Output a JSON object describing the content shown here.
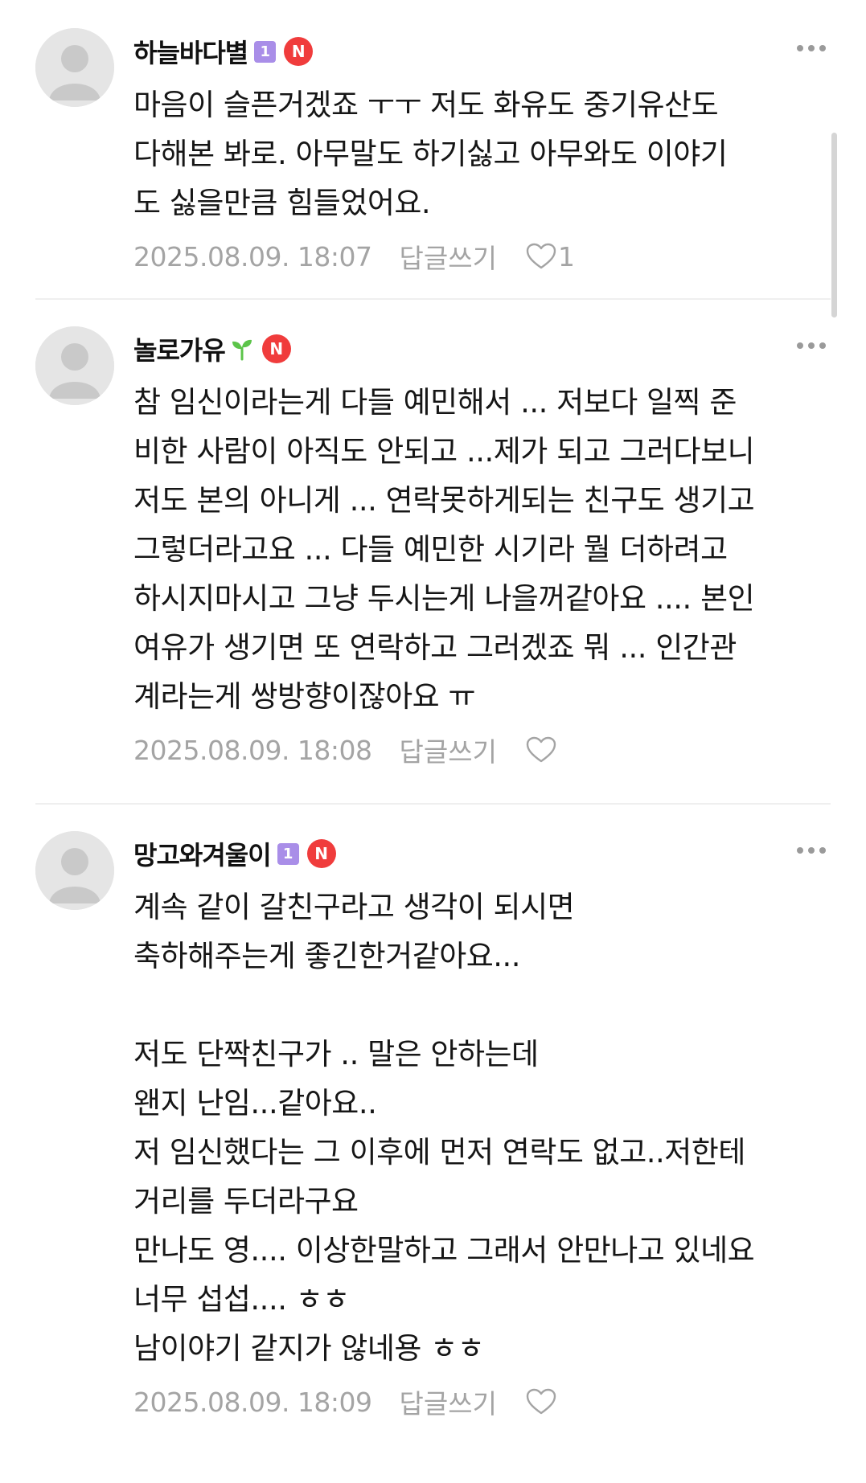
{
  "comments": [
    {
      "nickname": "하늘바다별",
      "level_badge": "1",
      "n_badge": "N",
      "lines": [
        "마음이 슬픈거겠죠 ㅜㅜ 저도 화유도 중기유산도",
        "다해본 봐로. 아무말도 하기싫고 아무와도 이야기",
        "도 싫을만큼 힘들었어요."
      ],
      "date": "2025.08.09. 18:07",
      "reply_label": "답글쓰기",
      "like_count": "1"
    },
    {
      "nickname": "놀로가유",
      "n_badge": "N",
      "lines": [
        "참 임신이라는게 다들 예민해서 ... 저보다 일찍 준",
        "비한 사람이 아직도 안되고 ...제가 되고 그러다보니",
        "저도 본의 아니게 ... 연락못하게되는 친구도 생기고",
        "그렇더라고요 ... 다들 예민한 시기라 뭘 더하려고",
        "하시지마시고 그냥 두시는게 나을꺼같아요 .... 본인",
        "여유가 생기면 또 연락하고 그러겠죠 뭐 ... 인간관",
        "계라는게 쌍방향이잖아요 ㅠ"
      ],
      "date": "2025.08.09. 18:08",
      "reply_label": "답글쓰기",
      "like_count": ""
    },
    {
      "nickname": "망고와겨울이",
      "level_badge": "1",
      "n_badge": "N",
      "lines": [
        "계속 같이 갈친구라고 생각이 되시면",
        "축하해주는게 좋긴한거같아요...",
        "",
        "저도 단짝친구가 .. 말은 안하는데",
        "왠지 난임...같아요..",
        "저 임신했다는 그 이후에 먼저 연락도 없고..저한테",
        "거리를 두더라구요",
        "만나도 영.... 이상한말하고 그래서 안만나고 있네요",
        "너무 섭섭.... ㅎㅎ",
        "남이야기 같지가 않네용 ㅎㅎ"
      ],
      "date": "2025.08.09. 18:09",
      "reply_label": "답글쓰기",
      "like_count": ""
    }
  ],
  "colors": {
    "level_badge": "#a98ee8",
    "n_badge": "#f03c3c",
    "sprout": "#5cc44a",
    "meta_text": "#a4a4a4"
  },
  "icons": {
    "more": "more-dots-icon",
    "like": "heart-outline-icon",
    "avatar": "default-avatar-icon",
    "sprout": "sprout-icon"
  }
}
